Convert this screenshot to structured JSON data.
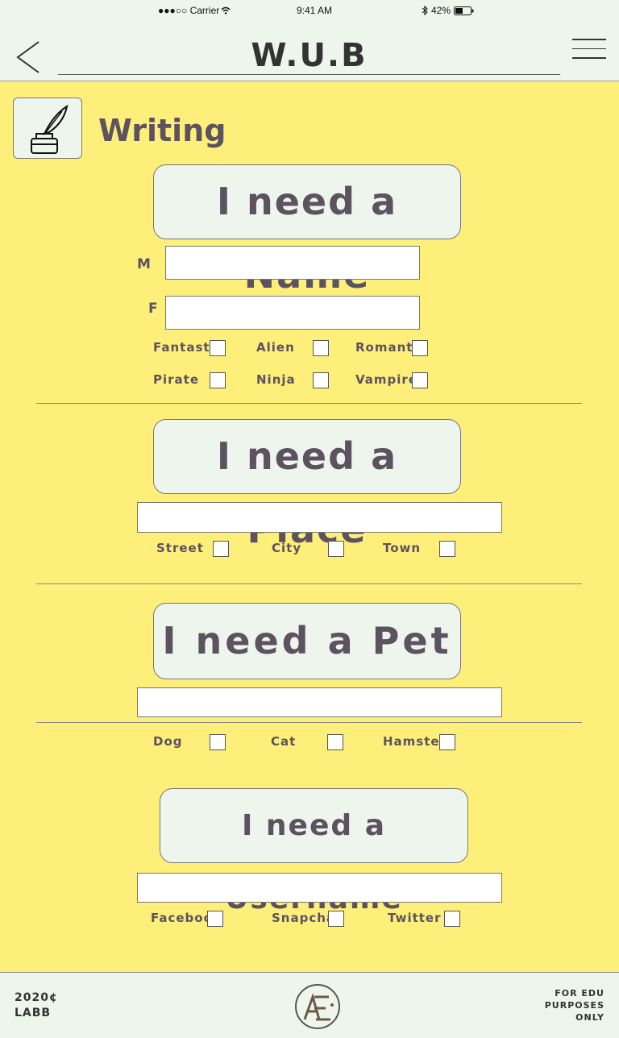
{
  "status_bar": {
    "carrier": "●●●○○ Carrier",
    "time": "9:41 AM",
    "battery": "42%"
  },
  "header": {
    "title": "W.U.B",
    "back_icon": "chevron-left-icon",
    "menu_icon": "hamburger-menu-icon"
  },
  "section": {
    "title": "Writing",
    "icon": "quill-inkwell-icon"
  },
  "name_block": {
    "button_label": "I need a Name",
    "male_label": "M",
    "female_label": "F",
    "male_value": "",
    "female_value": "",
    "options": [
      "Fantasty",
      "Alien",
      "Romantic",
      "Pirate",
      "Ninja",
      "Vampire"
    ]
  },
  "place_block": {
    "button_label": "I need a Place",
    "value": "",
    "options": [
      "Street",
      "City",
      "Town"
    ]
  },
  "pet_block": {
    "button_label": "I need a Pet",
    "value": "",
    "options": [
      "Dog",
      "Cat",
      "Hamster"
    ]
  },
  "username_block": {
    "button_label": "I need a Username",
    "value": "",
    "options": [
      "Facebook",
      "Snapchat",
      "Twitter"
    ]
  },
  "footer": {
    "left_line1": "2020¢",
    "left_line2": "LABB",
    "right_line1": "FOR EDU",
    "right_line2": "PURPOSES",
    "right_line3": "ONLY",
    "logo_icon": "ae-logo-icon"
  },
  "colors": {
    "background": "#fdef7a",
    "panel": "#eef5ec",
    "text": "#5c5260"
  }
}
